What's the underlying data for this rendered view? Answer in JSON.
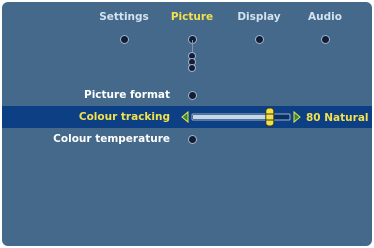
{
  "tabs": [
    {
      "label": "Settings"
    },
    {
      "label": "Picture"
    },
    {
      "label": "Display"
    },
    {
      "label": "Audio"
    }
  ],
  "active_tab": "Picture",
  "menu": {
    "picture_format_label": "Picture format",
    "colour_tracking_label": "Colour tracking",
    "colour_temperature_label": "Colour temperature"
  },
  "slider": {
    "value": 80,
    "value_text": "80 Natural",
    "level_fraction": 0.8
  },
  "colors": {
    "background": "#45698a",
    "selection": "#0d3f84",
    "highlight": "#f2e14c",
    "text": "#ffffff",
    "tab_text": "#d3e2f0"
  }
}
